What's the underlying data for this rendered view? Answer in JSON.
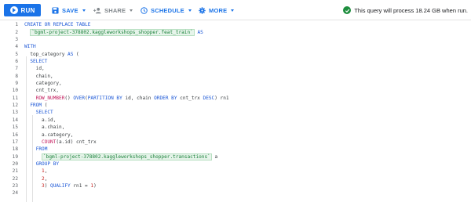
{
  "toolbar": {
    "run_label": "RUN",
    "save_label": "SAVE",
    "share_label": "SHARE",
    "schedule_label": "SCHEDULE",
    "more_label": "MORE",
    "validator_text": "This query will process 18.24 GB when run."
  },
  "icons": {
    "run": "play-icon",
    "save": "save-icon",
    "share": "person-add-icon",
    "schedule": "clock-icon",
    "more": "gear-icon",
    "validator": "check-circle-icon"
  },
  "colors": {
    "accent": "#1a73e8",
    "keyword": "#1a56d6",
    "function": "#c2185b",
    "string": "#188038",
    "number": "#c5221f",
    "ok": "#1e8e3e"
  },
  "editor": {
    "lines": [
      {
        "n": "1",
        "segs": [
          {
            "t": "CREATE OR REPLACE TABLE",
            "c": "kw"
          }
        ]
      },
      {
        "n": "2",
        "segs": [
          {
            "t": "  "
          },
          {
            "t": "`bgml-project-378802.kaggleworkshops_shopper.feat_train`",
            "c": "str"
          },
          {
            "t": " "
          },
          {
            "t": "AS",
            "c": "kw"
          }
        ]
      },
      {
        "n": "3",
        "segs": []
      },
      {
        "n": "4",
        "segs": [
          {
            "t": "WITH",
            "c": "kw"
          }
        ]
      },
      {
        "n": "5",
        "segs": [
          {
            "t": "  top_category "
          },
          {
            "t": "AS",
            "c": "kw"
          },
          {
            "t": " ("
          }
        ]
      },
      {
        "n": "6",
        "segs": [
          {
            "t": "  "
          },
          {
            "t": "SELECT",
            "c": "kw"
          }
        ]
      },
      {
        "n": "7",
        "segs": [
          {
            "t": "    id,"
          }
        ]
      },
      {
        "n": "8",
        "segs": [
          {
            "t": "    chain,"
          }
        ]
      },
      {
        "n": "9",
        "segs": [
          {
            "t": "    category,"
          }
        ]
      },
      {
        "n": "10",
        "segs": [
          {
            "t": "    cnt_trx,"
          }
        ]
      },
      {
        "n": "11",
        "segs": [
          {
            "t": "    "
          },
          {
            "t": "ROW_NUMBER",
            "c": "fn"
          },
          {
            "t": "() "
          },
          {
            "t": "OVER",
            "c": "kw"
          },
          {
            "t": "("
          },
          {
            "t": "PARTITION BY",
            "c": "kw"
          },
          {
            "t": " id, chain "
          },
          {
            "t": "ORDER BY",
            "c": "kw"
          },
          {
            "t": " cnt_trx "
          },
          {
            "t": "DESC",
            "c": "kw"
          },
          {
            "t": ") rn1"
          }
        ]
      },
      {
        "n": "12",
        "segs": [
          {
            "t": "  "
          },
          {
            "t": "FROM",
            "c": "kw"
          },
          {
            "t": " ("
          }
        ]
      },
      {
        "n": "13",
        "segs": [
          {
            "t": "    "
          },
          {
            "t": "SELECT",
            "c": "kw"
          }
        ]
      },
      {
        "n": "14",
        "segs": [
          {
            "t": "      a.id,"
          }
        ]
      },
      {
        "n": "15",
        "segs": [
          {
            "t": "      a.chain,"
          }
        ]
      },
      {
        "n": "16",
        "segs": [
          {
            "t": "      a.category,"
          }
        ]
      },
      {
        "n": "17",
        "segs": [
          {
            "t": "      "
          },
          {
            "t": "COUNT",
            "c": "fn"
          },
          {
            "t": "(a.id) cnt_trx"
          }
        ]
      },
      {
        "n": "18",
        "segs": [
          {
            "t": "    "
          },
          {
            "t": "FROM",
            "c": "kw"
          }
        ]
      },
      {
        "n": "19",
        "segs": [
          {
            "t": "      "
          },
          {
            "t": "`bgml-project-378802.kaggleworkshops_shopper.transactions`",
            "c": "str"
          },
          {
            "t": " a"
          }
        ]
      },
      {
        "n": "20",
        "segs": [
          {
            "t": "    "
          },
          {
            "t": "GROUP BY",
            "c": "kw"
          }
        ]
      },
      {
        "n": "21",
        "segs": [
          {
            "t": "      "
          },
          {
            "t": "1",
            "c": "num"
          },
          {
            "t": ","
          }
        ]
      },
      {
        "n": "22",
        "segs": [
          {
            "t": "      "
          },
          {
            "t": "2",
            "c": "num"
          },
          {
            "t": ","
          }
        ]
      },
      {
        "n": "23",
        "segs": [
          {
            "t": "      "
          },
          {
            "t": "3",
            "c": "num"
          },
          {
            "t": ") "
          },
          {
            "t": "QUALIFY",
            "c": "kw"
          },
          {
            "t": " rn1 = "
          },
          {
            "t": "1",
            "c": "num"
          },
          {
            "t": ")"
          }
        ]
      },
      {
        "n": "24",
        "segs": []
      }
    ]
  }
}
